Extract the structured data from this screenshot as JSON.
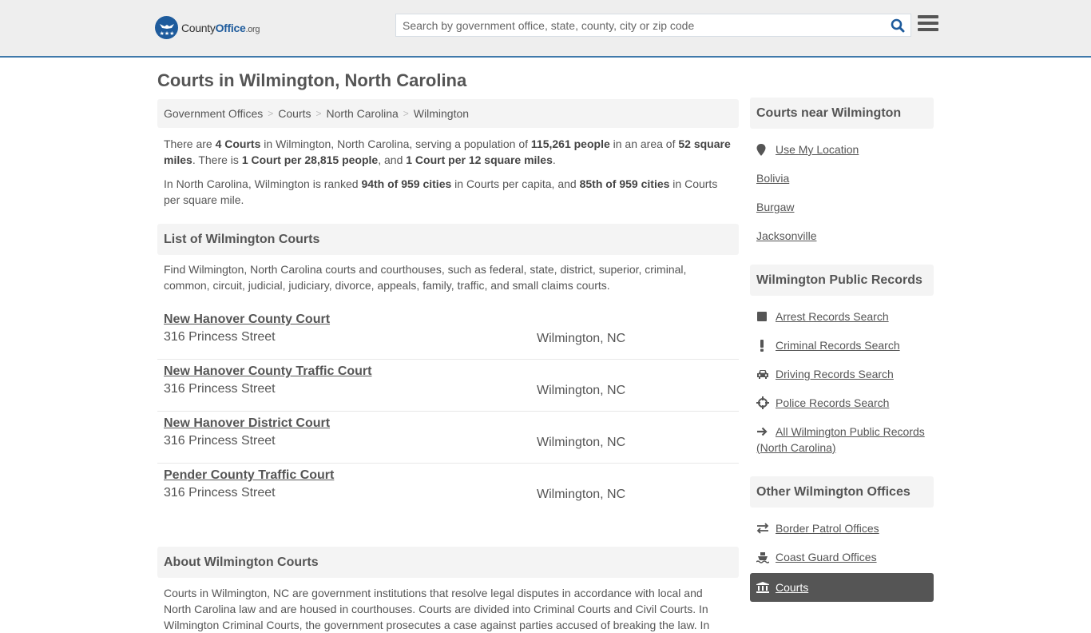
{
  "header": {
    "logo": {
      "name_part1": "County",
      "name_part2": "Office",
      "name_part3": ".org"
    },
    "search": {
      "placeholder": "Search by government office, state, county, city or zip code",
      "value": ""
    },
    "colors": {
      "brand": "#1e5b9c",
      "accent_border": "#3f79aa"
    }
  },
  "page": {
    "title": "Courts in Wilmington, North Carolina"
  },
  "breadcrumb": [
    {
      "label": "Government Offices"
    },
    {
      "label": "Courts"
    },
    {
      "label": "North Carolina"
    },
    {
      "label": "Wilmington"
    }
  ],
  "summary": {
    "p1": {
      "t1": "There are ",
      "b1": "4 Courts",
      "t2": " in Wilmington, North Carolina, serving a population of ",
      "b2": "115,261 people",
      "t3": " in an area of ",
      "b3": "52 square miles",
      "t4": ". There is ",
      "b4": "1 Court per 28,815 people",
      "t5": ", and ",
      "b5": "1 Court per 12 square miles",
      "t6": "."
    },
    "p2": {
      "t1": "In North Carolina, Wilmington is ranked ",
      "b1": "94th of 959 cities",
      "t2": " in Courts per capita, and ",
      "b2": "85th of 959 cities",
      "t3": " in Courts per square mile."
    }
  },
  "list_section": {
    "heading": "List of Wilmington Courts",
    "description": "Find Wilmington, North Carolina courts and courthouses, such as federal, state, district, superior, criminal, common, circuit, judicial, judiciary, divorce, appeals, family, traffic, and small claims courts.",
    "courts": [
      {
        "name": "New Hanover County Court",
        "address": "316 Princess Street",
        "city": "Wilmington, NC"
      },
      {
        "name": "New Hanover County Traffic Court",
        "address": "316 Princess Street",
        "city": "Wilmington, NC"
      },
      {
        "name": "New Hanover District Court",
        "address": "316 Princess Street",
        "city": "Wilmington, NC"
      },
      {
        "name": "Pender County Traffic Court",
        "address": "316 Princess Street",
        "city": "Wilmington, NC"
      }
    ]
  },
  "about_section": {
    "heading": "About Wilmington Courts",
    "text": "Courts in Wilmington, NC are government institutions that resolve legal disputes in accordance with local and North Carolina law and are housed in courthouses. Courts are divided into Criminal Courts and Civil Courts. In Wilmington Criminal Courts, the government prosecutes a case against parties accused of breaking the law. In"
  },
  "sidebar": {
    "nearby": {
      "heading": "Courts near Wilmington",
      "use_location": {
        "label": "Use My Location",
        "icon": "map-marker-icon"
      },
      "cities": [
        {
          "label": "Bolivia"
        },
        {
          "label": "Burgaw"
        },
        {
          "label": "Jacksonville"
        }
      ]
    },
    "public_records": {
      "heading": "Wilmington Public Records",
      "items": [
        {
          "label": "Arrest Records Search",
          "icon": "square-icon"
        },
        {
          "label": "Criminal Records Search",
          "icon": "exclamation-icon"
        },
        {
          "label": "Driving Records Search",
          "icon": "car-icon"
        },
        {
          "label": "Police Records Search",
          "icon": "crosshairs-icon"
        },
        {
          "label": "All Wilmington Public Records (North Carolina)",
          "icon": "arrow-right-icon"
        }
      ]
    },
    "other_offices": {
      "heading": "Other Wilmington Offices",
      "items": [
        {
          "label": "Border Patrol Offices",
          "icon": "exchange-icon"
        },
        {
          "label": "Coast Guard Offices",
          "icon": "ship-icon"
        },
        {
          "label": "Courts",
          "icon": "courthouse-icon",
          "active": true
        }
      ],
      "active_color": "#555555"
    }
  }
}
